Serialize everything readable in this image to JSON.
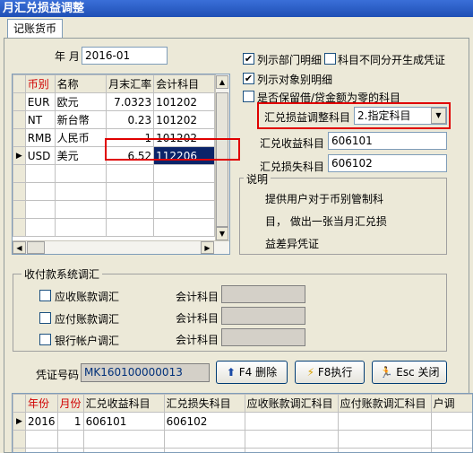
{
  "window": {
    "title": "月汇兑损益调整"
  },
  "tabs": [
    {
      "label": "记账货币"
    }
  ],
  "period": {
    "label": "年 月",
    "value": "2016-01"
  },
  "rate_grid": {
    "headers": [
      "币别",
      "名称",
      "月末汇率",
      "会计科目"
    ],
    "rows": [
      {
        "code": "EUR",
        "name": "欧元",
        "rate": "7.0323",
        "account": "101202"
      },
      {
        "code": "NT",
        "name": "新台幣",
        "rate": "0.23",
        "account": "101202"
      },
      {
        "code": "RMB",
        "name": "人民币",
        "rate": "1",
        "account": "101202"
      },
      {
        "code": "USD",
        "name": "美元",
        "rate": "6.52",
        "account": "112206"
      }
    ]
  },
  "options": {
    "dept_detail": {
      "label": "列示部门明细",
      "checked": true
    },
    "no_diff_voucher": {
      "label": "科目不同分开生成凭证",
      "checked": false
    },
    "object_detail": {
      "label": "列示对象别明细",
      "checked": true
    },
    "keep_balance": {
      "label": "是否保留借/贷金额为零的科目",
      "checked": false
    }
  },
  "adjust": {
    "label": "汇兑损益调整科目",
    "selected": "2.指定科目",
    "gain_label": "汇兑收益科目",
    "gain_value": "606101",
    "loss_label": "汇兑损失科目",
    "loss_value": "606102"
  },
  "note": {
    "title": "说明",
    "lines": [
      "提供用户对于币别管制科",
      "目， 做出一张当月汇兑损",
      "益差异凭证"
    ]
  },
  "settle": {
    "title": "收付款系统调汇",
    "items": [
      {
        "label": "应收账款调汇",
        "acct_label": "会计科目"
      },
      {
        "label": "应付账款调汇",
        "acct_label": "会计科目"
      },
      {
        "label": "银行帐户调汇",
        "acct_label": "会计科目"
      }
    ]
  },
  "voucher": {
    "label": "凭证号码",
    "value": "MK160100000013"
  },
  "buttons": {
    "delete": "F4 删除",
    "execute": "F8执行",
    "close": "Esc 关闭"
  },
  "result_grid": {
    "headers": [
      "年份",
      "月份",
      "汇兑收益科目",
      "汇兑损失科目",
      "应收账款调汇科目",
      "应付账款调汇科目",
      "户调"
    ],
    "rows": [
      {
        "year": "2016",
        "month": "1",
        "gain": "606101",
        "loss": "606102"
      }
    ]
  }
}
